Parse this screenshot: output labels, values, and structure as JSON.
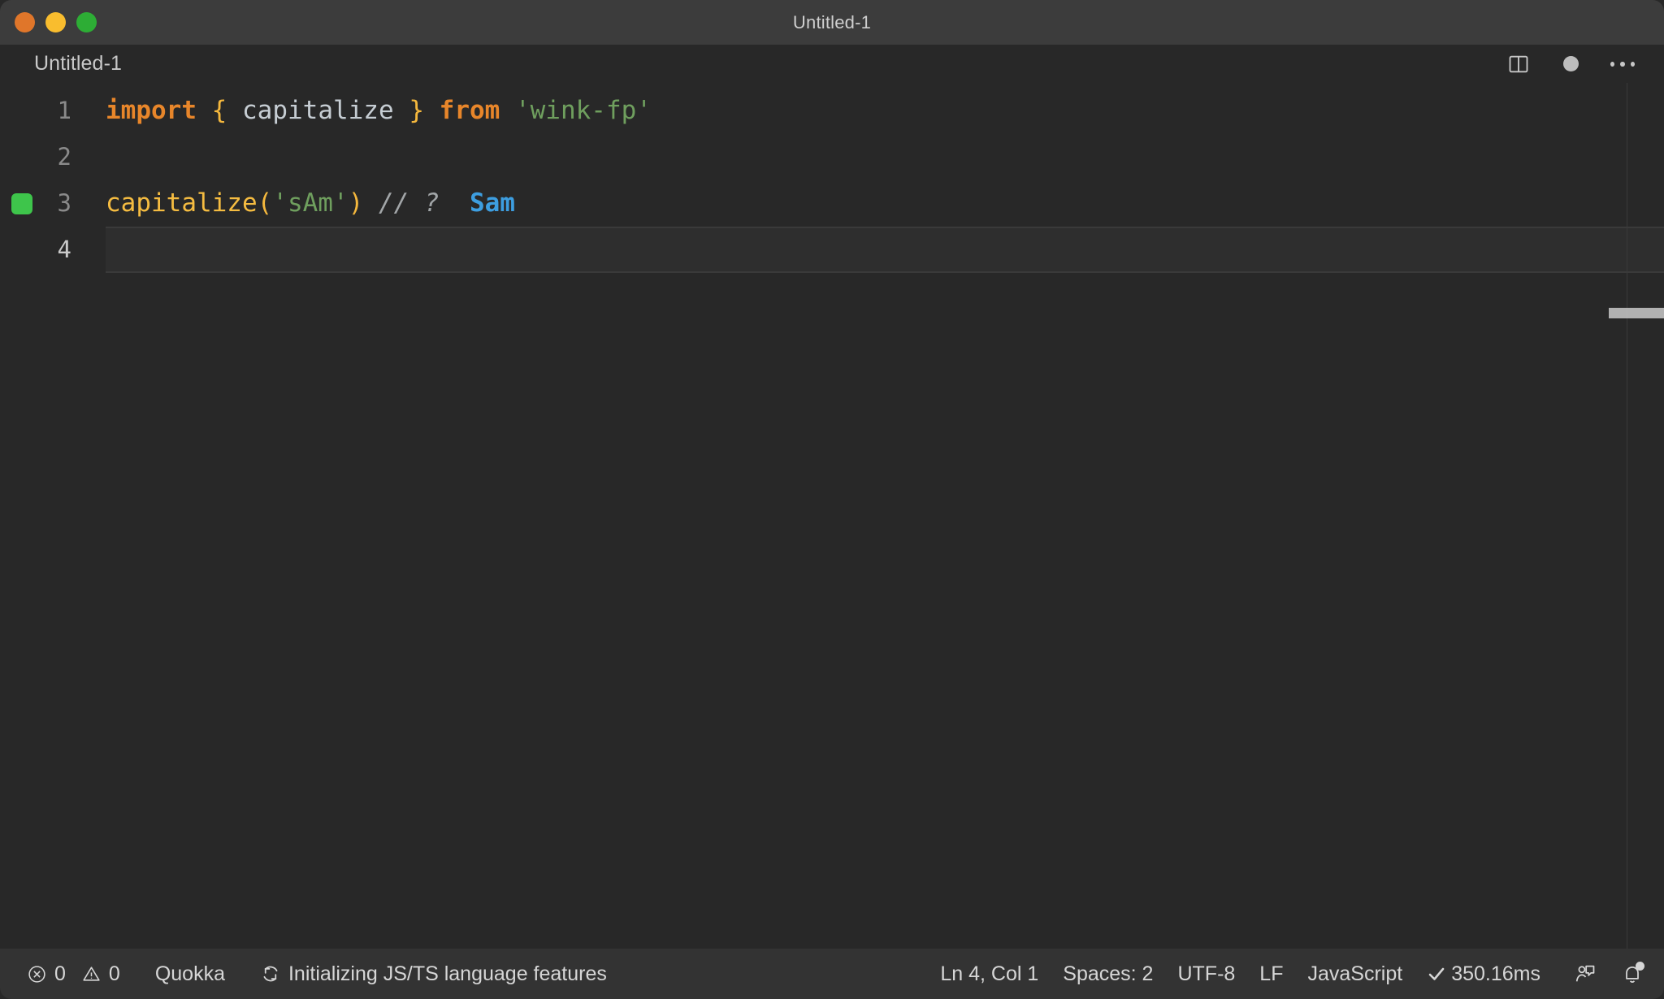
{
  "window": {
    "title": "Untitled-1",
    "traffic_lights": [
      {
        "name": "close",
        "color": "#e0762a"
      },
      {
        "name": "minimize",
        "color": "#f9bd2e"
      },
      {
        "name": "maximize",
        "color": "#2dad35"
      }
    ]
  },
  "editor_header": {
    "breadcrumb": "Untitled-1",
    "actions": [
      {
        "icon": "split-editor-icon",
        "label": "Split Editor"
      },
      {
        "icon": "unsaved-dot-icon",
        "label": "Unsaved changes"
      },
      {
        "icon": "more-actions-icon",
        "label": "More Actions..."
      }
    ]
  },
  "editor": {
    "language": "JavaScript",
    "lines": [
      {
        "number": "1",
        "glyph": "",
        "active": false,
        "tokens": [
          {
            "text": "import",
            "type": "kw"
          },
          {
            "text": " ",
            "type": "plain"
          },
          {
            "text": "{",
            "type": "brace"
          },
          {
            "text": " ",
            "type": "plain"
          },
          {
            "text": "capitalize",
            "type": "ident"
          },
          {
            "text": " ",
            "type": "plain"
          },
          {
            "text": "}",
            "type": "brace"
          },
          {
            "text": " ",
            "type": "plain"
          },
          {
            "text": "from",
            "type": "kw"
          },
          {
            "text": " ",
            "type": "plain"
          },
          {
            "text": "'wink-fp'",
            "type": "str"
          }
        ]
      },
      {
        "number": "2",
        "glyph": "",
        "active": false,
        "tokens": []
      },
      {
        "number": "3",
        "glyph": "quokka-ok",
        "active": false,
        "tokens": [
          {
            "text": "capitalize",
            "type": "fn"
          },
          {
            "text": "(",
            "type": "paren"
          },
          {
            "text": "'sAm'",
            "type": "str"
          },
          {
            "text": ")",
            "type": "paren"
          },
          {
            "text": " ",
            "type": "plain"
          },
          {
            "text": "// ?",
            "type": "comment"
          },
          {
            "text": "  ",
            "type": "plain"
          },
          {
            "text": "Sam",
            "type": "result"
          }
        ]
      },
      {
        "number": "4",
        "glyph": "",
        "active": true,
        "tokens": []
      }
    ]
  },
  "statusbar": {
    "left": [
      {
        "name": "problems",
        "icon": "error-circle-icon",
        "errors": "0",
        "warn_icon": "warning-triangle-icon",
        "warnings": "0"
      },
      {
        "name": "quokka",
        "label": "Quokka"
      },
      {
        "name": "language-status",
        "icon": "sync-icon",
        "label": "Initializing JS/TS language features"
      }
    ],
    "right": [
      {
        "name": "cursor-position",
        "label": "Ln 4, Col 1"
      },
      {
        "name": "indentation",
        "label": "Spaces: 2"
      },
      {
        "name": "encoding",
        "label": "UTF-8"
      },
      {
        "name": "eol",
        "label": "LF"
      },
      {
        "name": "language-mode",
        "label": "JavaScript"
      },
      {
        "name": "quokka-timing",
        "icon": "check-icon",
        "label": "350.16ms"
      },
      {
        "name": "feedback",
        "icon": "feedback-icon",
        "label": ""
      },
      {
        "name": "notifications",
        "icon": "bell-icon",
        "label": ""
      }
    ]
  },
  "colors": {
    "titlebar_bg": "#3c3c3c",
    "editor_bg": "#282828",
    "statusbar_bg": "#333333",
    "keyword": "#e8862a",
    "string": "#6f9f5e",
    "function": "#f5bc41",
    "brace": "#f5b83d",
    "comment": "#a2a6a8",
    "result": "#3d9ee0",
    "quokka_ok": "#3ec54b"
  }
}
